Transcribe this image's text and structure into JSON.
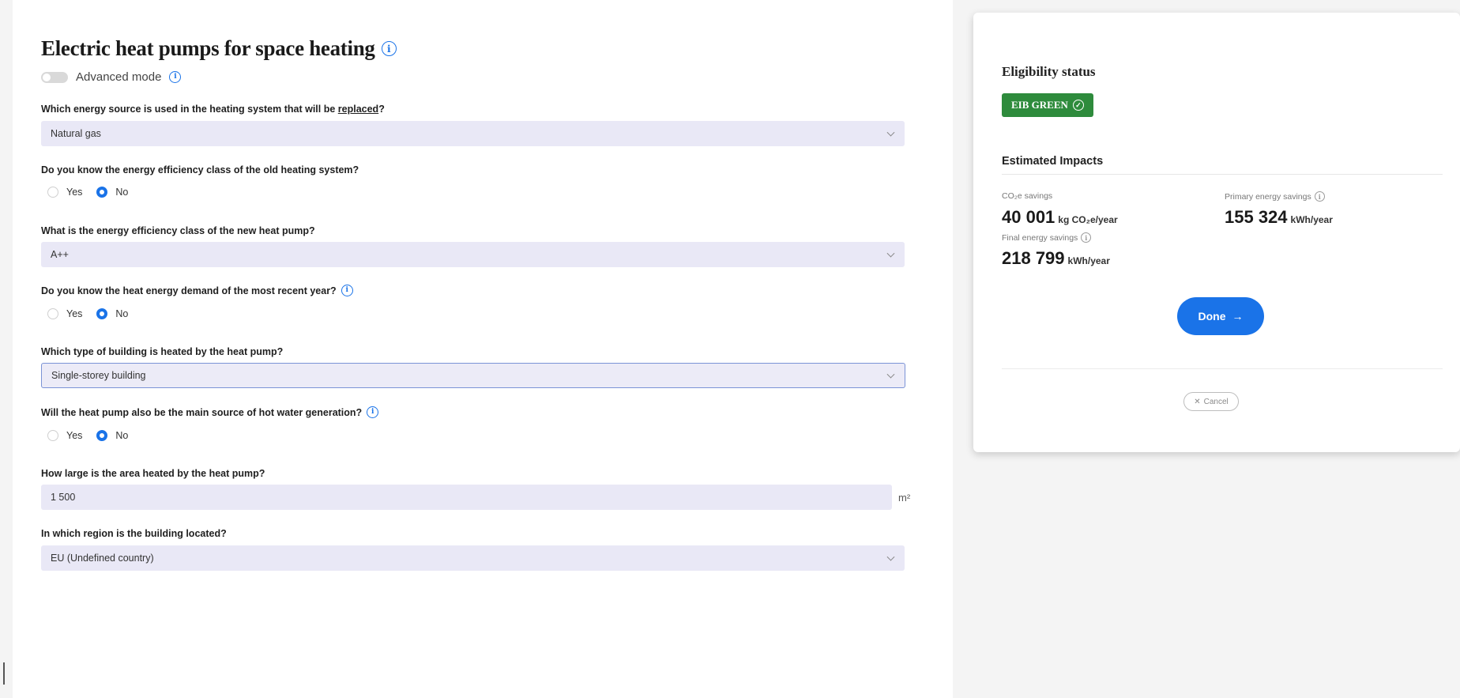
{
  "form": {
    "title": "Electric heat pumps for space heating",
    "advanced_mode_label": "Advanced mode",
    "q1": {
      "label_start": "Which energy source is used in the heating system that will be ",
      "label_link": "replaced",
      "label_end": "?",
      "value": "Natural gas"
    },
    "q2": {
      "label": "Do you know the energy efficiency class of the old heating system?",
      "yes": "Yes",
      "no": "No",
      "selected": "No"
    },
    "q3": {
      "label": "What is the energy efficiency class of the new heat pump?",
      "value": "A++"
    },
    "q4": {
      "label": "Do you know the heat energy demand of the most recent year?",
      "yes": "Yes",
      "no": "No",
      "selected": "No"
    },
    "q5": {
      "label": "Which type of building is heated by the heat pump?",
      "value": "Single-storey building"
    },
    "q6": {
      "label": "Will the heat pump also be the main source of hot water generation?",
      "yes": "Yes",
      "no": "No",
      "selected": "No"
    },
    "q7": {
      "label": "How large is the area heated by the heat pump?",
      "value": "1 500",
      "unit": "m²"
    },
    "q8": {
      "label": "In which region is the building located?",
      "value": "EU (Undefined country)"
    }
  },
  "result": {
    "eligibility_title": "Eligibility status",
    "badge": "EIB GREEN",
    "impacts_title": "Estimated Impacts",
    "co2_label": "CO₂e savings",
    "co2_value": "40 001",
    "co2_unit": "kg CO₂e/year",
    "primary_label": "Primary energy savings",
    "primary_value": "155 324",
    "primary_unit": "kWh/year",
    "final_label": "Final energy savings",
    "final_value": "218 799",
    "final_unit": "kWh/year",
    "done_label": "Done",
    "cancel_label": "Cancel"
  },
  "colors": {
    "accent": "#1a73e8",
    "badge_green": "#2e8b3c",
    "field_bg": "#e9e8f6"
  },
  "icons": [
    "info-icon",
    "chevron-down-icon",
    "check-circle-icon",
    "arrow-right-icon",
    "close-icon"
  ]
}
